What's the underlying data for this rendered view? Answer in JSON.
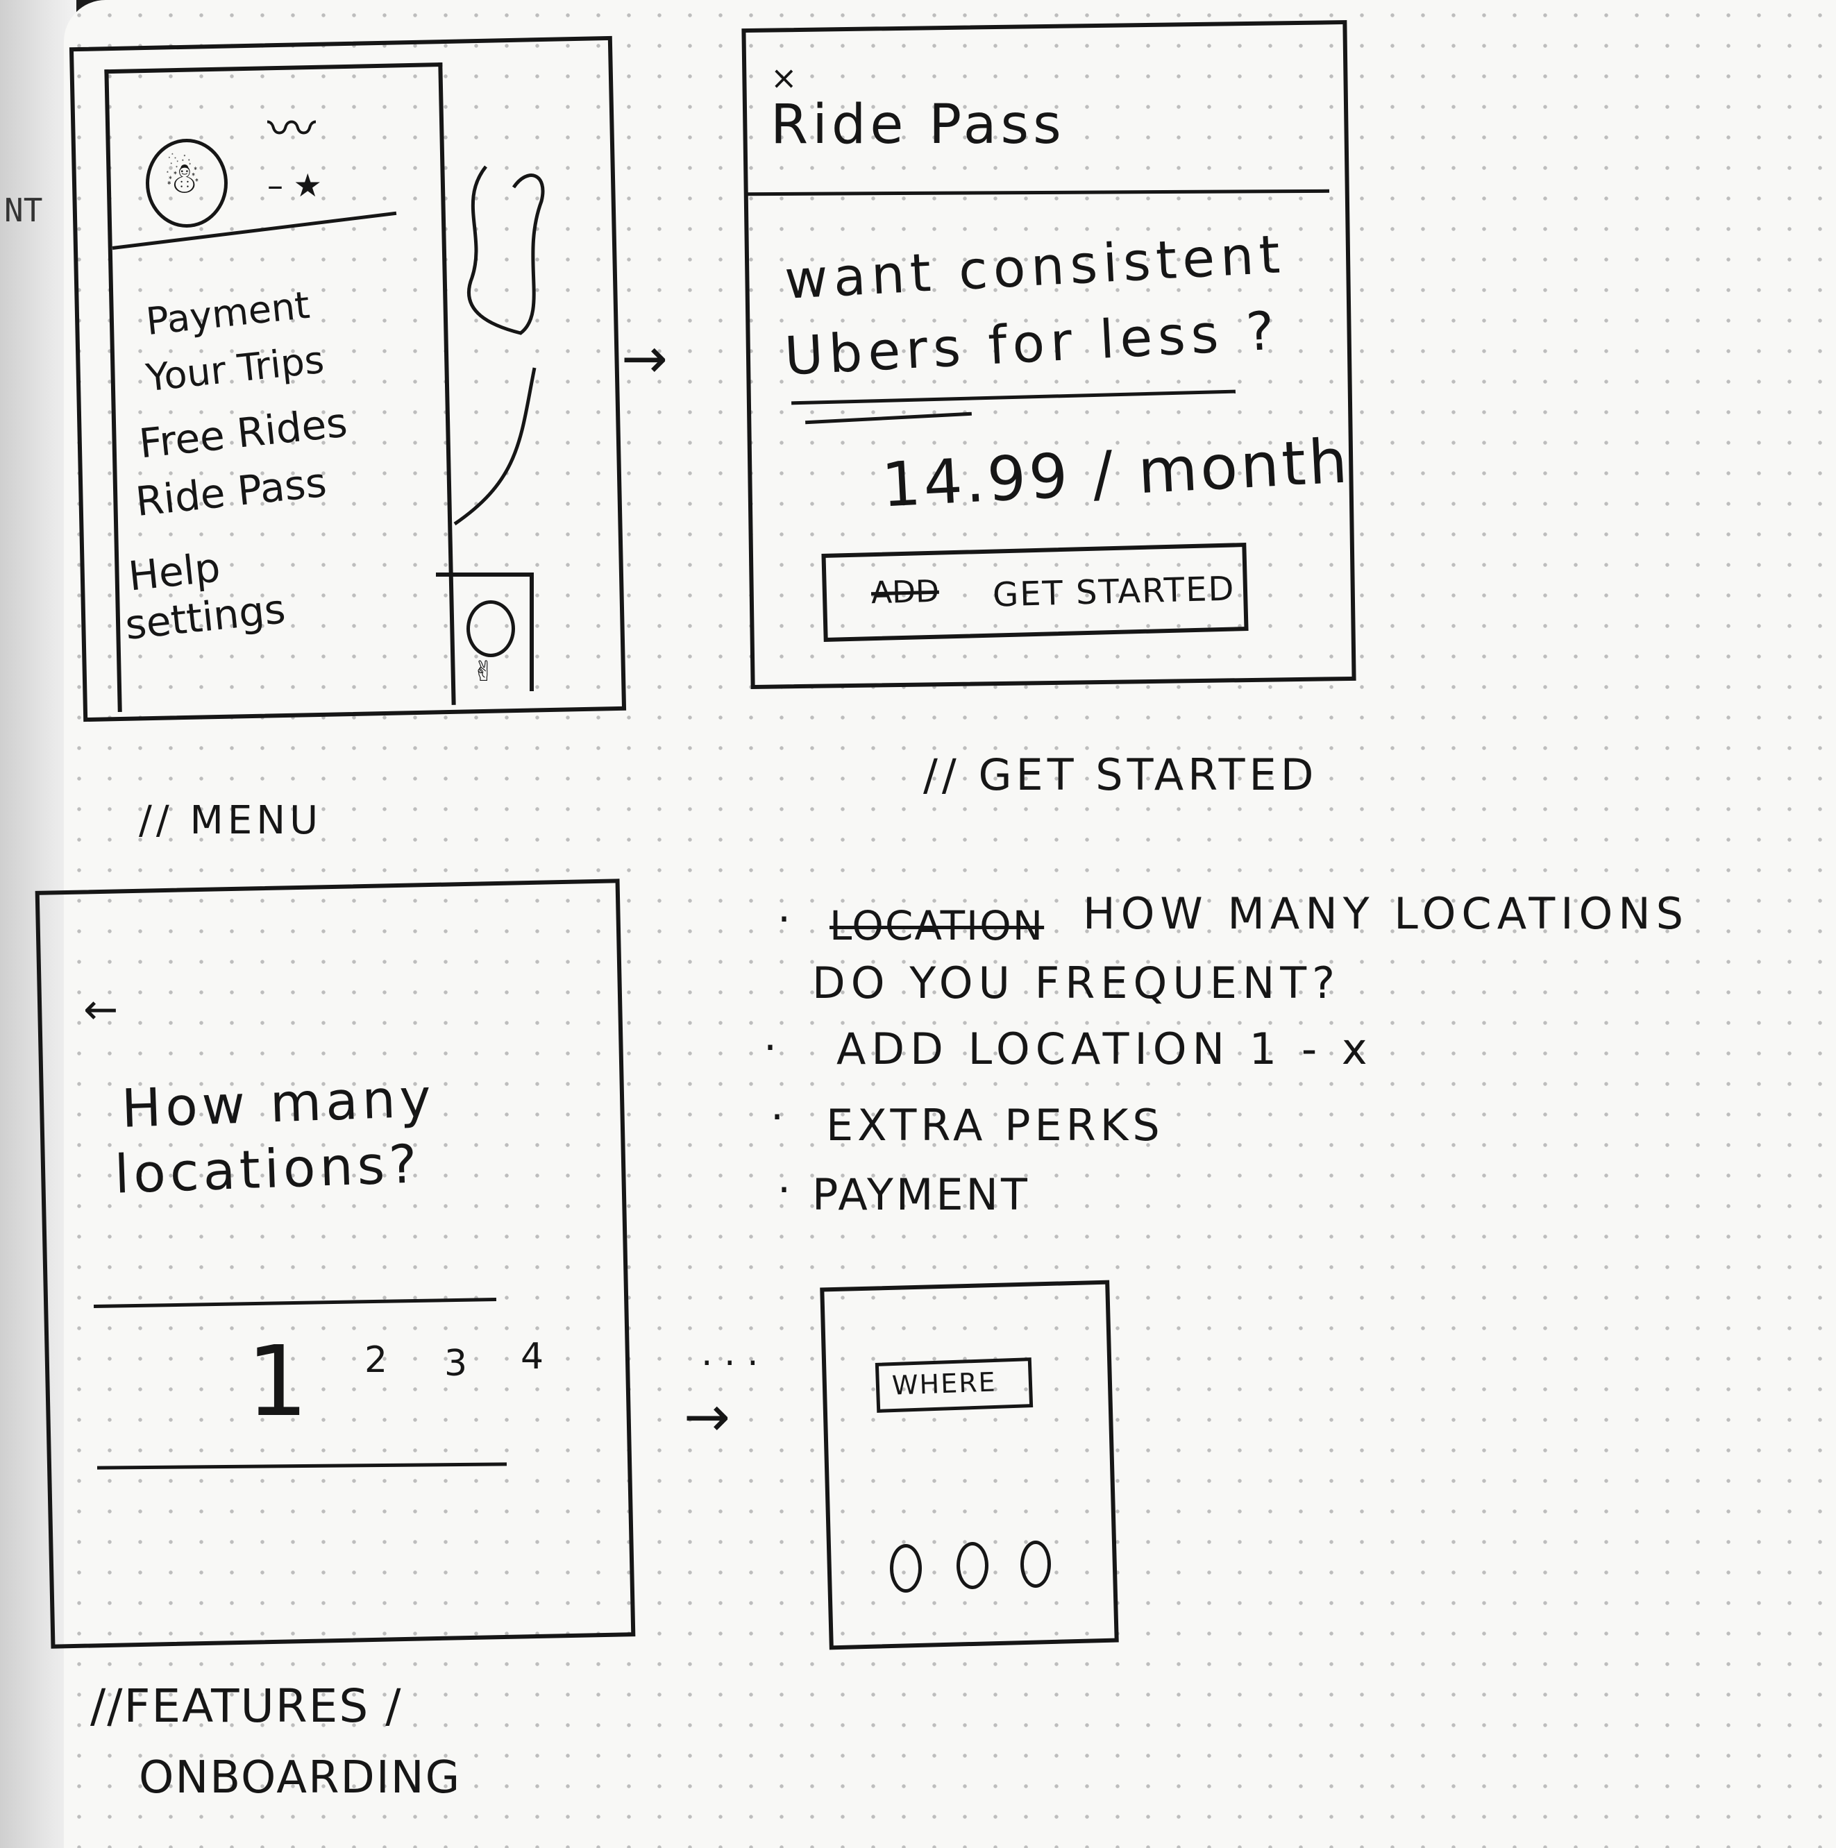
{
  "left_page": {
    "text": "NT"
  },
  "menu_sketch": {
    "items": [
      "Payment",
      "Your Trips",
      "Free Rides",
      "Ride Pass",
      "Help",
      "settings"
    ],
    "caption": "// MENU"
  },
  "get_started_sketch": {
    "close_glyph": "×",
    "title": "Ride Pass",
    "headline_line1": "want consistent",
    "headline_line2": "Ubers for less ?",
    "price": "14.99 / month",
    "button_crossed": "ADD",
    "button_label": "GET STARTED",
    "caption": "// GET STARTED"
  },
  "features_sketch": {
    "back_glyph": "←",
    "question_line1": "How many",
    "question_line2": "locations?",
    "numbers": [
      "1",
      "2",
      "3",
      "4"
    ],
    "caption_line1": "//FEATURES /",
    "caption_line2": "ONBOARDING"
  },
  "notes": {
    "crossed_word": "LOCATION",
    "items": [
      {
        "line1": "HOW MANY LOCATIONS",
        "line2": "DO YOU FREQUENT?"
      },
      {
        "line1": "ADD LOCATION 1 - x"
      },
      {
        "line1": "EXTRA PERKS"
      },
      {
        "line1": "PAYMENT"
      }
    ]
  },
  "where_sketch": {
    "ellipsis": ". . .",
    "input_label": "WHERE"
  }
}
